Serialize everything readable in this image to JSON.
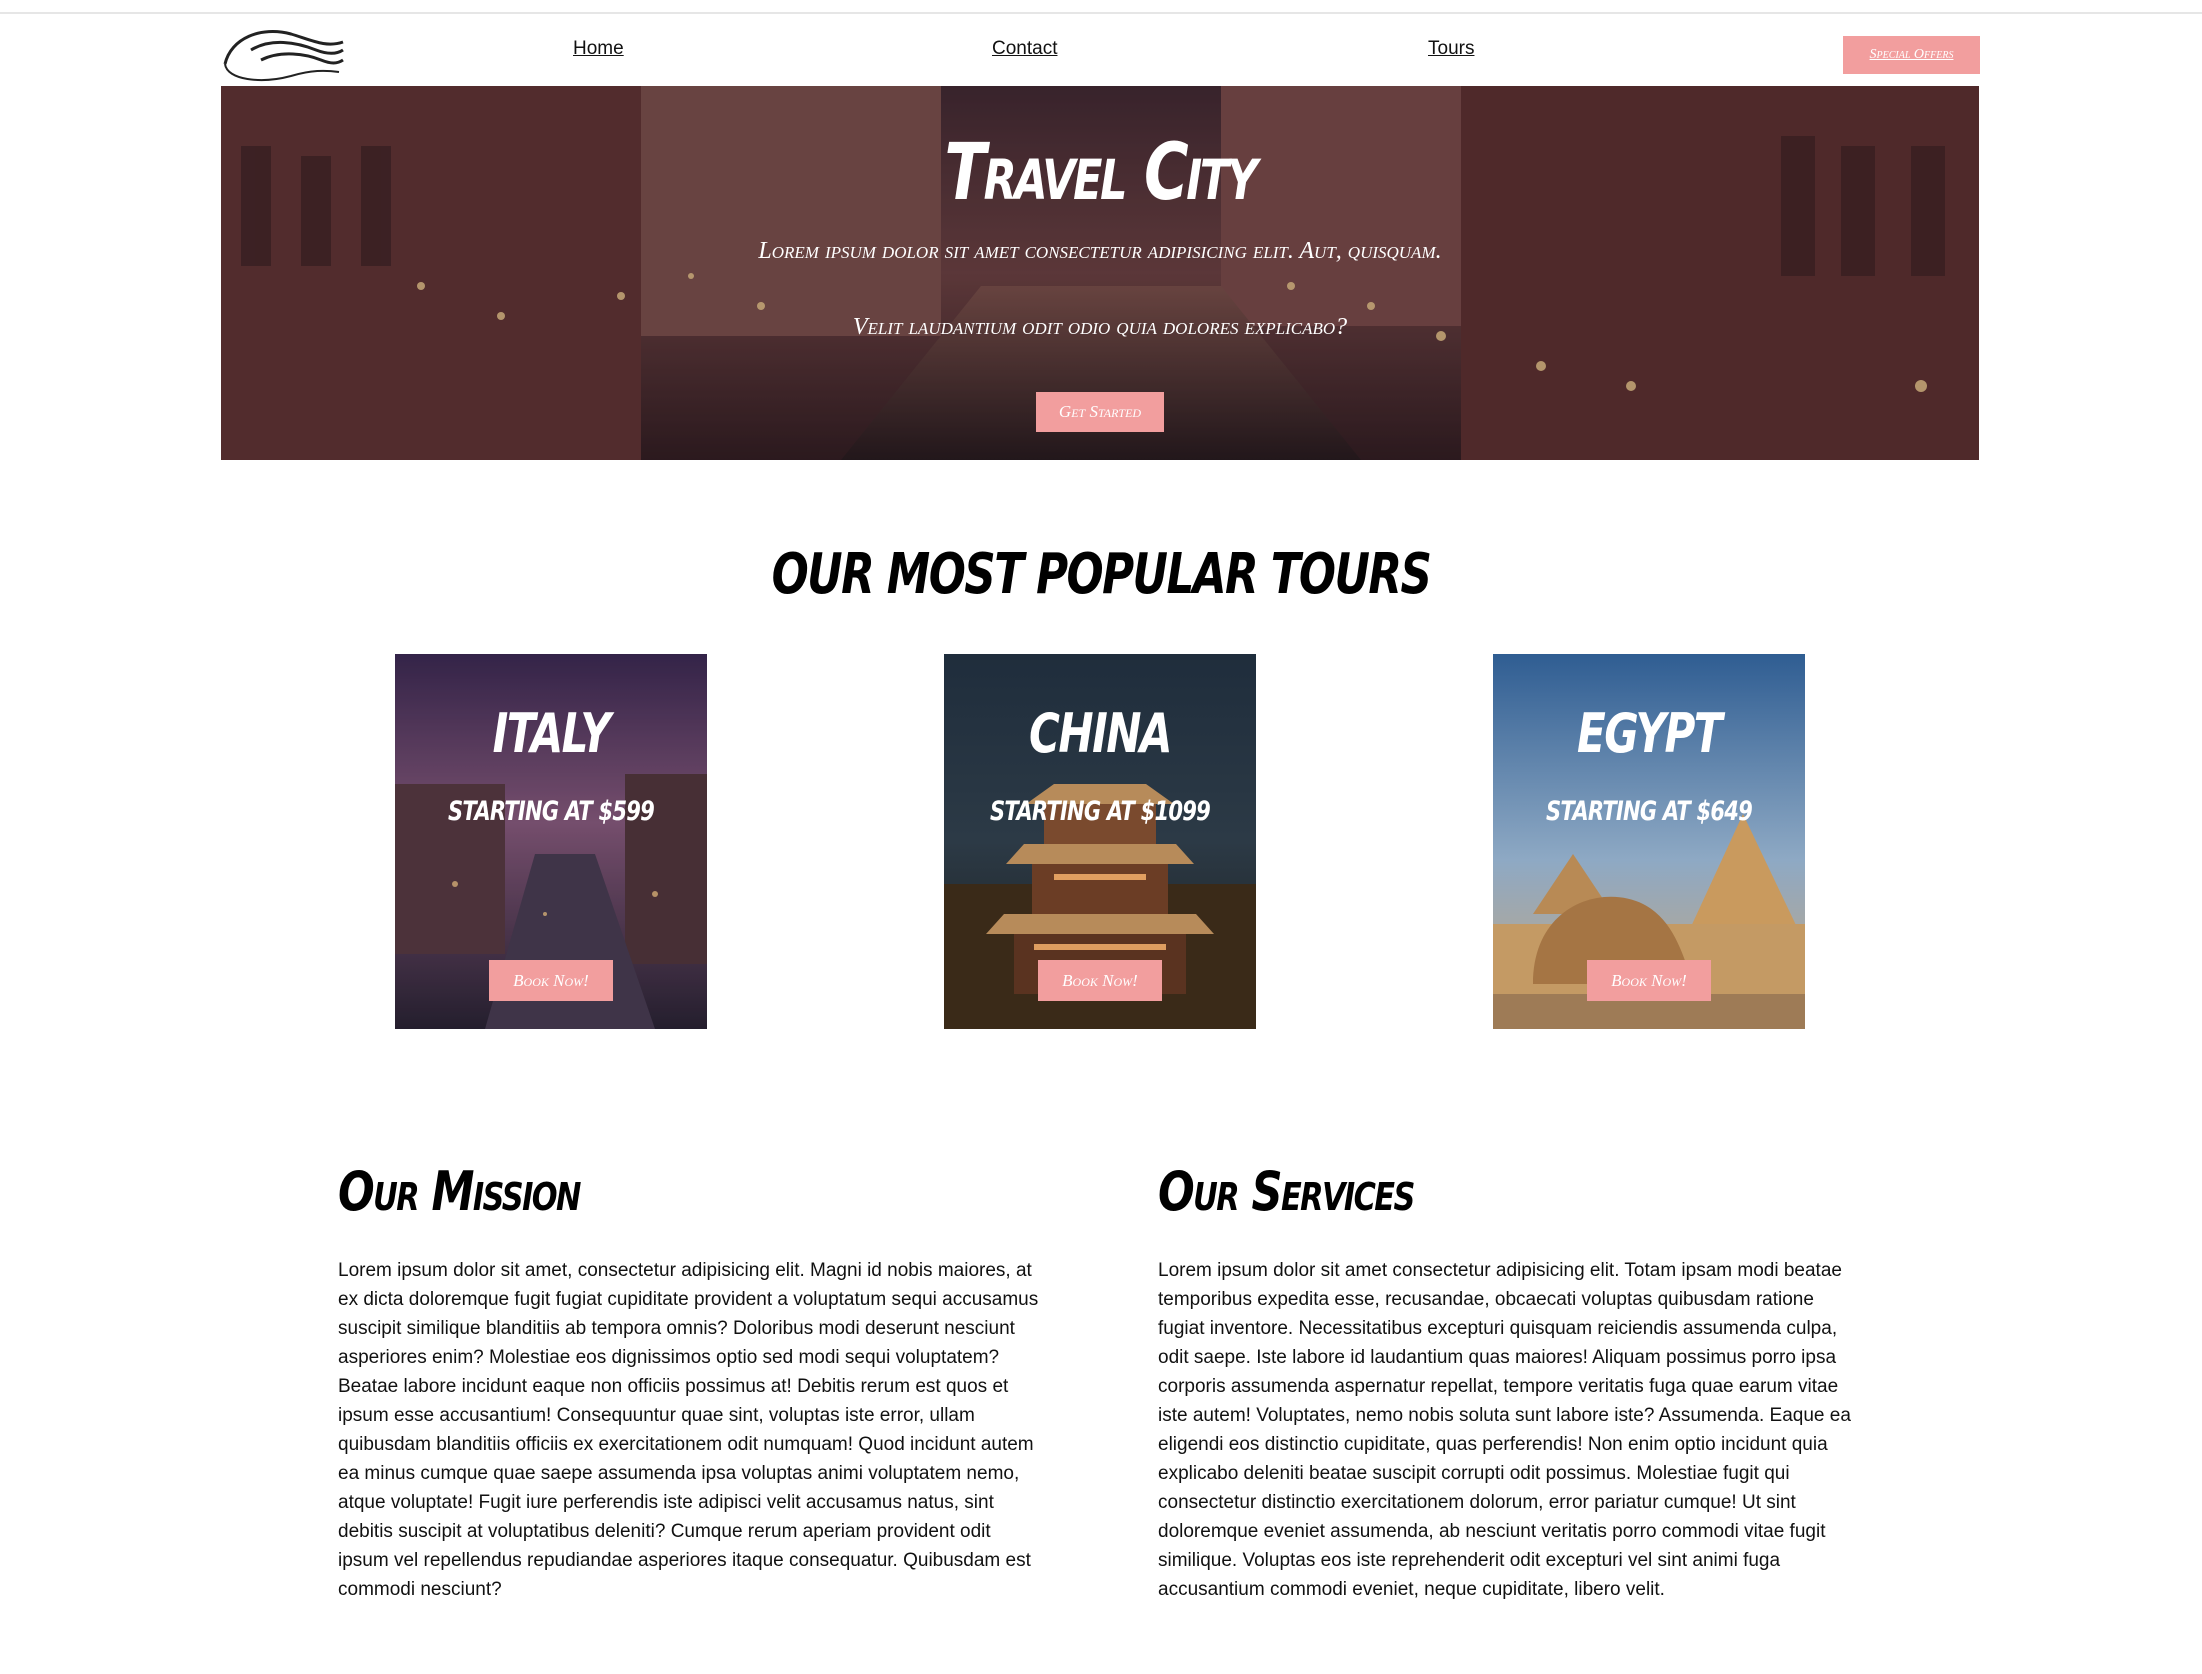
{
  "nav": {
    "logo": "wave-logo",
    "links": [
      "Home",
      "Contact",
      "Tours"
    ],
    "special_offers": "Special Offers"
  },
  "hero": {
    "title": "Travel City",
    "subtitle_line1": "Lorem ipsum dolor sit amet consectetur adipisicing elit. Aut, quisquam.",
    "subtitle_line2": "Velit laudantium odit odio quia dolores explicabo?",
    "cta": "Get Started"
  },
  "tours": {
    "heading": "OUR MOST POPULAR TOURS",
    "cards": [
      {
        "name": "ITALY",
        "price": "STARTING AT $599",
        "button": "Book Now!"
      },
      {
        "name": "CHINA",
        "price": "STARTING AT $1099",
        "button": "Book Now!"
      },
      {
        "name": "EGYPT",
        "price": "STARTING AT $649",
        "button": "Book Now!"
      }
    ]
  },
  "mission": {
    "title": "Our Mission",
    "text": "Lorem ipsum dolor sit amet, consectetur adipisicing elit. Magni id nobis maiores, at ex dicta doloremque fugit fugiat cupiditate provident a voluptatum sequi accusamus suscipit similique blanditiis ab tempora omnis? Doloribus modi deserunt nesciunt asperiores enim? Molestiae eos dignissimos optio sed modi sequi voluptatem? Beatae labore incidunt eaque non officiis possimus at! Debitis rerum est quos et ipsum esse accusantium! Consequuntur quae sint, voluptas iste error, ullam quibusdam blanditiis officiis ex exercitationem odit numquam! Quod incidunt autem ea minus cumque quae saepe assumenda ipsa voluptas animi voluptatem nemo, atque voluptate! Fugit iure perferendis iste adipisci velit accusamus natus, sint debitis suscipit at voluptatibus deleniti? Cumque rerum aperiam provident odit ipsum vel repellendus repudiandae asperiores itaque consequatur. Quibusdam est commodi nesciunt?"
  },
  "services": {
    "title": "Our Services",
    "text": "Lorem ipsum dolor sit amet consectetur adipisicing elit. Totam ipsam modi beatae temporibus expedita esse, recusandae, obcaecati voluptas quibusdam ratione fugiat inventore. Necessitatibus excepturi quisquam reiciendis assumenda culpa, odit saepe. Iste labore id laudantium quas maiores! Aliquam possimus porro ipsa corporis assumenda aspernatur repellat, tempore veritatis fuga quae earum vitae iste autem! Voluptates, nemo nobis soluta sunt labore iste? Assumenda. Eaque ea eligendi eos distinctio cupiditate, quas perferendis! Non enim optio incidunt quia explicabo deleniti beatae suscipit corrupti odit possimus. Molestiae fugit qui consectetur distinctio exercitationem dolorum, error pariatur cumque! Ut sint doloremque eveniet assumenda, ab nesciunt veritatis porro commodi vitae fugit similique. Voluptas eos iste reprehenderit odit excepturi vel sint animi fuga accusantium commodi eveniet, neque cupiditate, libero velit."
  },
  "colors": {
    "accent": "#f29e9e",
    "text": "#111111",
    "background": "#ffffff"
  }
}
